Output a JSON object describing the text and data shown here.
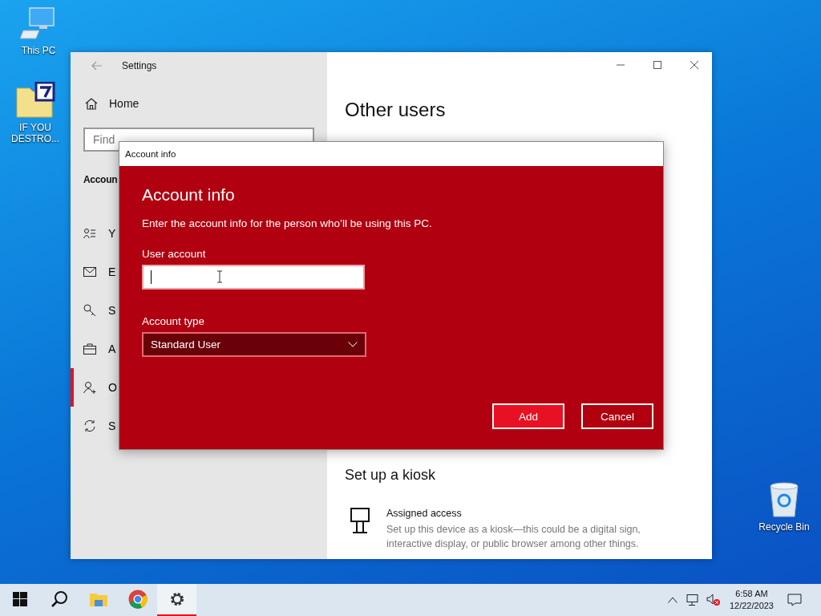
{
  "desktop_icons": [
    {
      "kind": "pc",
      "label": "This PC"
    },
    {
      "kind": "archive",
      "label": "IF YOU DESTRO..."
    },
    {
      "kind": "bin",
      "label": "Recycle Bin"
    }
  ],
  "settings_window": {
    "title": "Settings",
    "home": "Home",
    "search": {
      "placeholder": "Find"
    },
    "section": "Accoun",
    "sidebar": {
      "items": [
        {
          "kind": "person-list",
          "label": "Y",
          "selected": false
        },
        {
          "kind": "mail",
          "label": "E",
          "selected": false
        },
        {
          "kind": "key",
          "label": "S",
          "selected": false
        },
        {
          "kind": "briefcase",
          "label": "A",
          "selected": false
        },
        {
          "kind": "person-add",
          "label": "O",
          "selected": true
        },
        {
          "kind": "sync",
          "label": "S",
          "selected": false
        }
      ]
    },
    "heading": "Other users",
    "kiosk_heading": "Set up a kiosk",
    "kiosk_item": {
      "title": "Assigned access",
      "description": "Set up this device as a kiosk—this could be a digital sign, interactive display, or public browser among other things."
    }
  },
  "dialog": {
    "title": "Account info",
    "heading": "Account info",
    "description": "Enter the account info for the person who’ll be using this PC.",
    "user_account": {
      "label": "User account",
      "focused": true
    },
    "account_type": {
      "label": "Account type",
      "value": "Standard User"
    },
    "buttons": [
      {
        "label": "Add",
        "primary": true
      },
      {
        "label": "Cancel",
        "primary": false
      }
    ]
  },
  "taskbar": {
    "items": [
      {
        "kind": "start",
        "selected": false
      },
      {
        "kind": "search",
        "selected": false
      },
      {
        "kind": "explorer",
        "selected": false
      },
      {
        "kind": "chrome",
        "selected": false
      },
      {
        "kind": "settings",
        "selected": true
      }
    ],
    "time": "6:58 AM",
    "date": "12/22/2023"
  }
}
